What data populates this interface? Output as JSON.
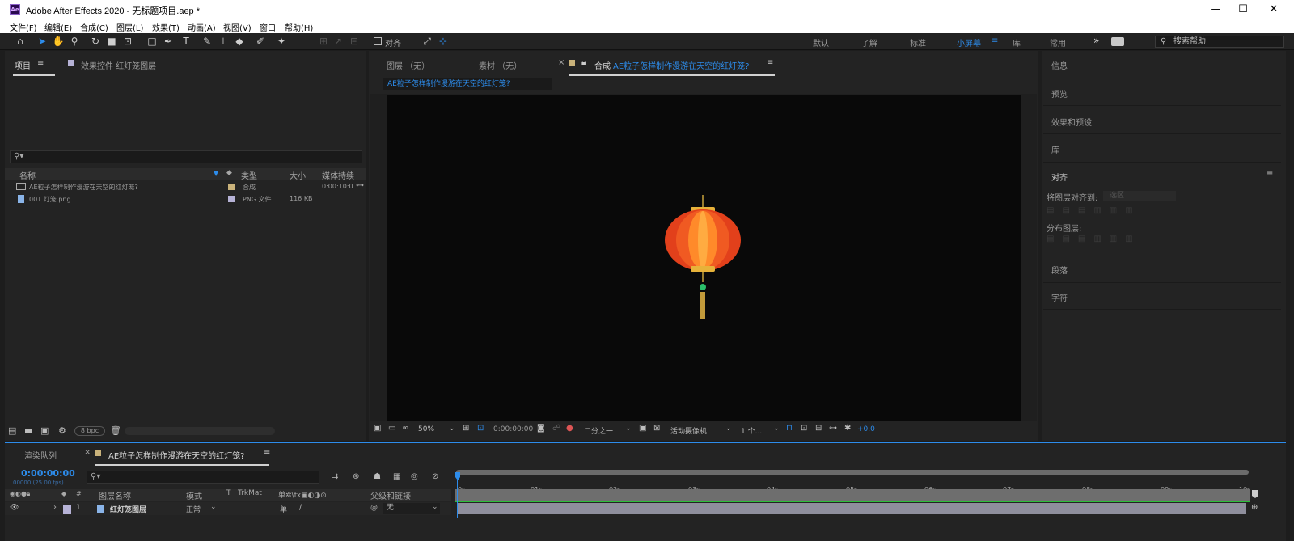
{
  "window": {
    "title": "Adobe After Effects 2020 - 无标题项目.aep *",
    "logo_text": "Ae",
    "minimize": "—",
    "maximize": "☐",
    "close": "✕"
  },
  "menu": [
    "文件(F)",
    "编辑(E)",
    "合成(C)",
    "图层(L)",
    "效果(T)",
    "动画(A)",
    "视图(V)",
    "窗口",
    "帮助(H)"
  ],
  "toolbar": {
    "snap_label": "对齐"
  },
  "workspaces": [
    "默认",
    "了解",
    "标准",
    "小屏幕",
    "库",
    "常用"
  ],
  "workspace_active": "小屏幕",
  "workspace_more": "»",
  "help_search": "搜索帮助",
  "project_panel": {
    "tab_project": "项目",
    "tab_effects": "效果控件 红灯笼图层",
    "columns": {
      "name": "名称",
      "type": "类型",
      "size": "大小",
      "duration": "媒体持续"
    },
    "items": [
      {
        "name": "AE粒子怎样制作漫游在天空的红灯笼?",
        "type": "合成",
        "size": "",
        "duration": "0:00:10:0",
        "color": "#c9b27a"
      },
      {
        "name": "001 灯笼.png",
        "type": "PNG 文件",
        "size": "116 KB",
        "duration": "",
        "color": "#b6b2d6"
      }
    ],
    "bpc": "8 bpc"
  },
  "comp_panel": {
    "tab_layer": "图层 （无）",
    "tab_footage": "素材 （无）",
    "tab_comp_prefix": "合成",
    "comp_name": "AE粒子怎样制作漫游在天空的红灯笼?",
    "breadcrumb": "AE粒子怎样制作漫游在天空的红灯笼?",
    "zoom": "50%",
    "timecode": "0:00:00:00",
    "resolution": "二分之一",
    "camera": "活动摄像机",
    "views": "1 个...",
    "exposure": "+0.0"
  },
  "right_panel": {
    "items": [
      "信息",
      "预览",
      "效果和预设",
      "库",
      "对齐",
      "段落",
      "字符"
    ],
    "align_to_label": "将图层对齐到:",
    "align_to_value": "选区",
    "distribute_label": "分布图层:"
  },
  "timeline": {
    "tab_render": "渲染队列",
    "tab_comp": "AE粒子怎样制作漫游在天空的红灯笼?",
    "timecode": "0:00:00:00",
    "frame_info": "00000 (25.00 fps)",
    "columns": {
      "layer_name": "图层名称",
      "mode": "模式",
      "t": "T",
      "trkmat": "TrkMat",
      "parent": "父级和链接"
    },
    "layer": {
      "index": "1",
      "name": "红灯笼图层",
      "mode": "正常",
      "parent": "无"
    },
    "ticks": [
      "0s",
      "01s",
      "02s",
      "03s",
      "04s",
      "05s",
      "06s",
      "07s",
      "08s",
      "09s",
      "10s"
    ]
  },
  "colors": {
    "accent": "#2d8ceb",
    "lantern": "#e2401b",
    "comp_label": "#c9b27a"
  }
}
